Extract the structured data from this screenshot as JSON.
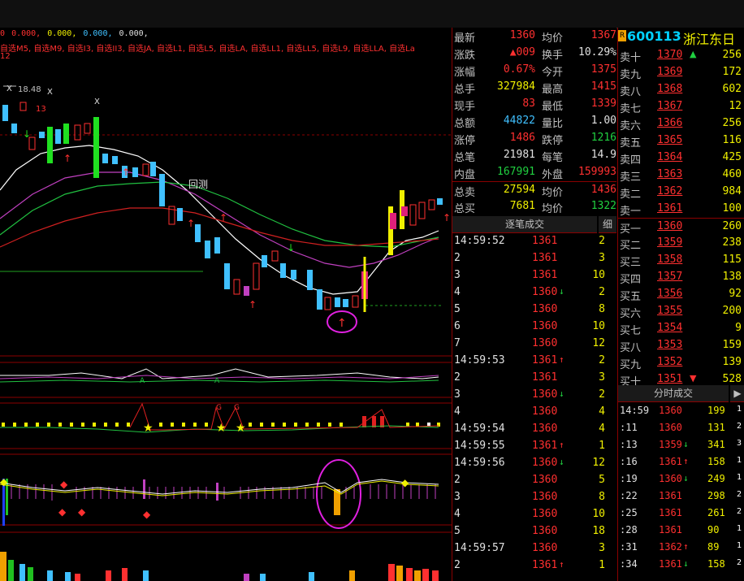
{
  "header": {
    "ma_values": [
      "0",
      "0.000,",
      "0.000,",
      "0.000,",
      "0.000,"
    ],
    "selection_line": "自选M5, 自选M9, 自选I3, 自选II3, 自选JA, 自选L1, 自选L5, 自选LA, 自选LL1, 自选LL5, 自选L9, 自选LLA, 自选La",
    "selection_line2": "12",
    "price_label": "18.48"
  },
  "stock": {
    "badge": "R",
    "code": "600113",
    "name": "浙江东日"
  },
  "quote": [
    {
      "label": "最新",
      "v1": "1360",
      "c1": "red",
      "label2": "均价",
      "v2": "1367",
      "c2": "red"
    },
    {
      "label": "涨跌",
      "v1": "▲009",
      "c1": "red",
      "label2": "换手",
      "v2": "10.29%",
      "c2": "white"
    },
    {
      "label": "涨幅",
      "v1": "0.67%",
      "c1": "red",
      "label2": "今开",
      "v2": "1375",
      "c2": "red"
    },
    {
      "label": "总手",
      "v1": "327984",
      "c1": "yellow",
      "label2": "最高",
      "v2": "1415",
      "c2": "red"
    },
    {
      "label": "现手",
      "v1": "83",
      "c1": "red",
      "label2": "最低",
      "v2": "1339",
      "c2": "red"
    },
    {
      "label": "总额",
      "v1": "44822",
      "c1": "cyan",
      "label2": "量比",
      "v2": "1.00",
      "c2": "white"
    },
    {
      "label": "涨停",
      "v1": "1486",
      "c1": "red",
      "label2": "跌停",
      "v2": "1216",
      "c2": "green"
    },
    {
      "label": "总笔",
      "v1": "21981",
      "c1": "white",
      "label2": "每笔",
      "v2": "14.9",
      "c2": "white"
    },
    {
      "label": "内盘",
      "v1": "167991",
      "c1": "green",
      "label2": "外盘",
      "v2": "159993",
      "c2": "red"
    },
    {
      "label": "总卖",
      "v1": "27594",
      "c1": "yellow",
      "label2": "均价",
      "v2": "1436",
      "c2": "red"
    },
    {
      "label": "总买",
      "v1": "7681",
      "c1": "yellow",
      "label2": "均价",
      "v2": "1322",
      "c2": "green"
    }
  ],
  "orders": [
    {
      "label": "卖十",
      "price": "1370",
      "arrow": "▲",
      "acol": "green",
      "vol": "256"
    },
    {
      "label": "卖九",
      "price": "1369",
      "arrow": "",
      "acol": "",
      "vol": "172"
    },
    {
      "label": "卖八",
      "price": "1368",
      "arrow": "",
      "acol": "",
      "vol": "602"
    },
    {
      "label": "卖七",
      "price": "1367",
      "arrow": "",
      "acol": "",
      "vol": "12"
    },
    {
      "label": "卖六",
      "price": "1366",
      "arrow": "",
      "acol": "",
      "vol": "256"
    },
    {
      "label": "卖五",
      "price": "1365",
      "arrow": "",
      "acol": "",
      "vol": "116"
    },
    {
      "label": "卖四",
      "price": "1364",
      "arrow": "",
      "acol": "",
      "vol": "425"
    },
    {
      "label": "卖三",
      "price": "1363",
      "arrow": "",
      "acol": "",
      "vol": "460"
    },
    {
      "label": "卖二",
      "price": "1362",
      "arrow": "",
      "acol": "",
      "vol": "984"
    },
    {
      "label": "卖一",
      "price": "1361",
      "arrow": "",
      "acol": "",
      "vol": "100"
    },
    {
      "label": "买一",
      "price": "1360",
      "arrow": "",
      "acol": "",
      "vol": "260"
    },
    {
      "label": "买二",
      "price": "1359",
      "arrow": "",
      "acol": "",
      "vol": "238"
    },
    {
      "label": "买三",
      "price": "1358",
      "arrow": "",
      "acol": "",
      "vol": "115"
    },
    {
      "label": "买四",
      "price": "1357",
      "arrow": "",
      "acol": "",
      "vol": "138"
    },
    {
      "label": "买五",
      "price": "1356",
      "arrow": "",
      "acol": "",
      "vol": "92"
    },
    {
      "label": "买六",
      "price": "1355",
      "arrow": "",
      "acol": "",
      "vol": "200"
    },
    {
      "label": "买七",
      "price": "1354",
      "arrow": "",
      "acol": "",
      "vol": "9"
    },
    {
      "label": "买八",
      "price": "1353",
      "arrow": "",
      "acol": "",
      "vol": "159"
    },
    {
      "label": "买九",
      "price": "1352",
      "arrow": "",
      "acol": "",
      "vol": "139"
    },
    {
      "label": "买十",
      "price": "1351",
      "arrow": "▼",
      "acol": "red",
      "vol": "528"
    }
  ],
  "trades_tab": {
    "title": "逐笔成交",
    "detail": "细"
  },
  "trades": [
    {
      "t": "14:59:52",
      "p": "1361",
      "a": "",
      "v": "2"
    },
    {
      "t": "2",
      "p": "1361",
      "a": "",
      "v": "3"
    },
    {
      "t": "3",
      "p": "1361",
      "a": "",
      "v": "10"
    },
    {
      "t": "4",
      "p": "1360",
      "a": "↓",
      "v": "2"
    },
    {
      "t": "5",
      "p": "1360",
      "a": "",
      "v": "8"
    },
    {
      "t": "6",
      "p": "1360",
      "a": "",
      "v": "10"
    },
    {
      "t": "7",
      "p": "1360",
      "a": "",
      "v": "12"
    },
    {
      "t": "14:59:53",
      "p": "1361",
      "a": "↑",
      "v": "2"
    },
    {
      "t": "2",
      "p": "1361",
      "a": "",
      "v": "3"
    },
    {
      "t": "3",
      "p": "1360",
      "a": "↓",
      "v": "2"
    },
    {
      "t": "4",
      "p": "1360",
      "a": "",
      "v": "4"
    },
    {
      "t": "14:59:54",
      "p": "1360",
      "a": "",
      "v": "4"
    },
    {
      "t": "14:59:55",
      "p": "1361",
      "a": "↑",
      "v": "1"
    },
    {
      "t": "14:59:56",
      "p": "1360",
      "a": "↓",
      "v": "12"
    },
    {
      "t": "2",
      "p": "1360",
      "a": "",
      "v": "5"
    },
    {
      "t": "3",
      "p": "1360",
      "a": "",
      "v": "8"
    },
    {
      "t": "4",
      "p": "1360",
      "a": "",
      "v": "10"
    },
    {
      "t": "5",
      "p": "1360",
      "a": "",
      "v": "18"
    },
    {
      "t": "14:59:57",
      "p": "1360",
      "a": "",
      "v": "3"
    },
    {
      "t": "2",
      "p": "1361",
      "a": "↑",
      "v": "1"
    }
  ],
  "minute_tab": {
    "title": "分时成交",
    "arrow": "▶"
  },
  "minute_trades": [
    {
      "t": "14:59",
      "p": "1360",
      "a": "",
      "v": "199",
      "b": "1"
    },
    {
      "t": ":11",
      "p": "1360",
      "a": "",
      "v": "131",
      "b": "2"
    },
    {
      "t": ":13",
      "p": "1359",
      "a": "↓",
      "v": "341",
      "b": "3"
    },
    {
      "t": ":16",
      "p": "1361",
      "a": "↑",
      "v": "158",
      "b": "1"
    },
    {
      "t": ":19",
      "p": "1360",
      "a": "↓",
      "v": "249",
      "b": "1"
    },
    {
      "t": ":22",
      "p": "1361",
      "a": "",
      "v": "298",
      "b": "2"
    },
    {
      "t": ":25",
      "p": "1361",
      "a": "",
      "v": "261",
      "b": "2"
    },
    {
      "t": ":28",
      "p": "1361",
      "a": "",
      "v": "90",
      "b": "1"
    },
    {
      "t": ":31",
      "p": "1362",
      "a": "↑",
      "v": "89",
      "b": "1"
    },
    {
      "t": ":34",
      "p": "1361",
      "a": "↓",
      "v": "158",
      "b": "2"
    }
  ],
  "chart_labels": {
    "breakout": "回测",
    "pane_letter_a": "A",
    "pane_letter_g": "G"
  }
}
